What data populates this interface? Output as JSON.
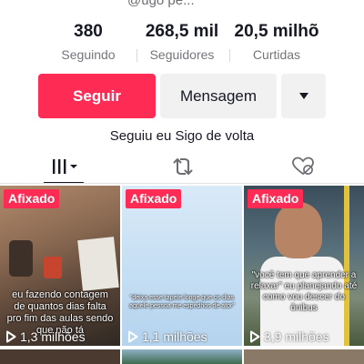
{
  "profile": {
    "handle": "@ugo pe..."
  },
  "stats": [
    {
      "value": "380",
      "label": "Seguindo"
    },
    {
      "value": "268,5 mil",
      "label": "Seguidores"
    },
    {
      "value": "20,5 milhõ",
      "label": "Curtidas"
    }
  ],
  "actions": {
    "follow_label": "Seguir",
    "message_label": "Mensagem",
    "more_icon": "caret-down-icon"
  },
  "bio": "Seguiu eu Sigo de volta",
  "tabs": [
    {
      "name": "videos",
      "icon": "grid-icon",
      "active": true
    },
    {
      "name": "reposts",
      "icon": "repost-icon",
      "active": false
    },
    {
      "name": "liked",
      "icon": "heart-hidden-icon",
      "active": false
    }
  ],
  "videos": [
    {
      "pinned_label": "Afixado",
      "caption": "eu fazendo contagem de quantos dias falta pro fim das aulas sendo que não tá",
      "views": "1,3 milhões"
    },
    {
      "pinned_label": "Afixado",
      "caption": "\"deixa esse tapete longe que os dias aquele pessoa me espedhos de ator\"",
      "views": "1,1 milhões"
    },
    {
      "pinned_label": "Afixado",
      "caption": "\"você tem que aprender a relaxar\" eu planejando até como vou descer do ônibus",
      "views": "3,9 milhões"
    }
  ],
  "colors": {
    "accent": "#fe2c55",
    "secondary_button": "#f1f1f2",
    "text": "#161823",
    "muted": "#75767c"
  }
}
